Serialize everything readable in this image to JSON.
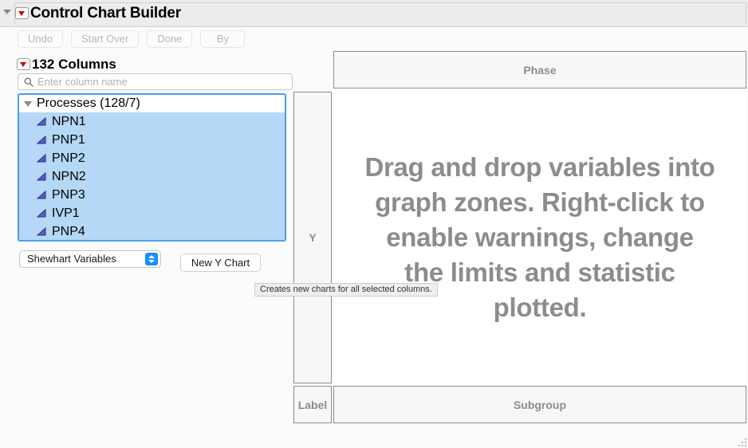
{
  "window": {
    "title": "Control Chart Builder",
    "disclosure_icon": "disclosure-triangle-icon",
    "menu_icon": "red-triangle-menu-icon"
  },
  "toolbar": {
    "buttons": [
      {
        "label": "Undo",
        "name": "undo-button"
      },
      {
        "label": "Start Over",
        "name": "start-over-button"
      },
      {
        "label": "Done",
        "name": "done-button"
      },
      {
        "label": "By",
        "name": "by-button"
      }
    ]
  },
  "columns_panel": {
    "title": "132 Columns",
    "search": {
      "placeholder": "Enter column name",
      "value": "",
      "icon": "search-icon"
    },
    "group": {
      "label": "Processes (128/7)",
      "expanded": true
    },
    "items": [
      {
        "label": "NPN1",
        "icon": "continuous-variable-icon",
        "selected": true
      },
      {
        "label": "PNP1",
        "icon": "continuous-variable-icon",
        "selected": true
      },
      {
        "label": "PNP2",
        "icon": "continuous-variable-icon",
        "selected": true
      },
      {
        "label": "NPN2",
        "icon": "continuous-variable-icon",
        "selected": true
      },
      {
        "label": "PNP3",
        "icon": "continuous-variable-icon",
        "selected": true
      },
      {
        "label": "IVP1",
        "icon": "continuous-variable-icon",
        "selected": true
      },
      {
        "label": "PNP4",
        "icon": "continuous-variable-icon",
        "selected": true
      }
    ],
    "chart_type": {
      "selected": "Shewhart Variables",
      "stepper_icon": "up-down-stepper-icon"
    },
    "new_chart_button": "New Y Chart"
  },
  "tooltip": {
    "text": "Creates new charts for all selected columns."
  },
  "builder": {
    "zones": {
      "phase": "Phase",
      "y": "Y",
      "label": "Label",
      "subgroup": "Subgroup"
    },
    "drop_hint": "Drag and drop variables into graph zones. Right-click to enable warnings, change the limits and statistic plotted."
  },
  "colors": {
    "selection_blue": "#b4d8f5",
    "focus_border": "#4a9eea",
    "zone_text": "#8c8c8c",
    "accent_blue": "#1a8cff",
    "red_triangle": "#d40000"
  }
}
